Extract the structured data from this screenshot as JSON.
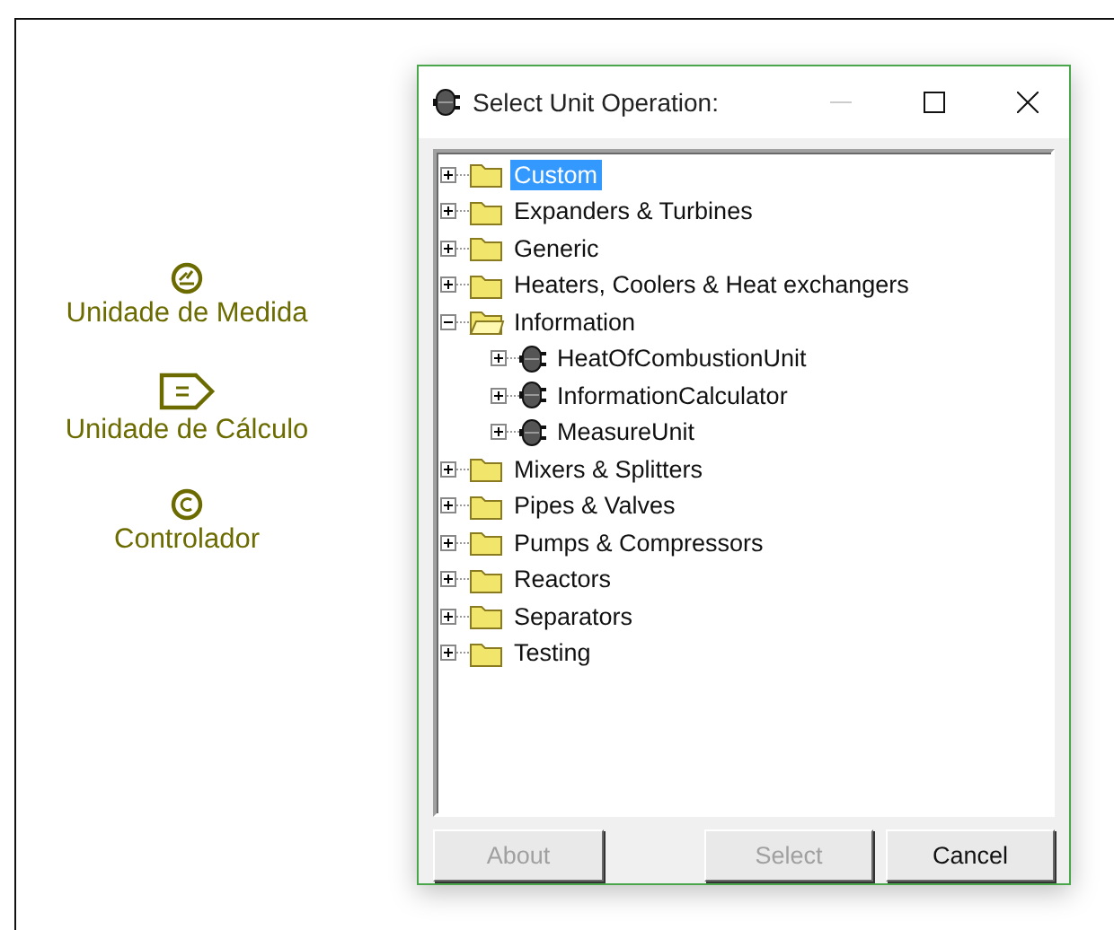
{
  "palette": [
    {
      "kind": "gauge",
      "label": "Unidade de Medida"
    },
    {
      "kind": "tag",
      "label": "Unidade de Cálculo"
    },
    {
      "kind": "controller",
      "label": "Controlador"
    }
  ],
  "dialog": {
    "title": "Select Unit Operation:",
    "tree": [
      {
        "kind": "folder",
        "label": "Custom",
        "selected": true,
        "expanded": false
      },
      {
        "kind": "folder",
        "label": "Expanders & Turbines",
        "selected": false,
        "expanded": false
      },
      {
        "kind": "folder",
        "label": "Generic",
        "selected": false,
        "expanded": false
      },
      {
        "kind": "folder",
        "label": "Heaters, Coolers & Heat exchangers",
        "selected": false,
        "expanded": false
      },
      {
        "kind": "folder",
        "label": "Information",
        "selected": false,
        "expanded": true,
        "children": [
          {
            "kind": "unit",
            "label": "HeatOfCombustionUnit",
            "selected": false,
            "expanded": false
          },
          {
            "kind": "unit",
            "label": "InformationCalculator",
            "selected": false,
            "expanded": false
          },
          {
            "kind": "unit",
            "label": "MeasureUnit",
            "selected": false,
            "expanded": false
          }
        ]
      },
      {
        "kind": "folder",
        "label": "Mixers & Splitters",
        "selected": false,
        "expanded": false
      },
      {
        "kind": "folder",
        "label": "Pipes & Valves",
        "selected": false,
        "expanded": false
      },
      {
        "kind": "folder",
        "label": "Pumps & Compressors",
        "selected": false,
        "expanded": false
      },
      {
        "kind": "folder",
        "label": "Reactors",
        "selected": false,
        "expanded": false
      },
      {
        "kind": "folder",
        "label": "Separators",
        "selected": false,
        "expanded": false
      },
      {
        "kind": "folder",
        "label": "Testing",
        "selected": false,
        "expanded": false
      }
    ],
    "buttons": [
      {
        "label": "About",
        "disabled": true
      },
      {
        "label": "Select",
        "disabled": true
      },
      {
        "label": "Cancel",
        "disabled": false
      }
    ]
  }
}
